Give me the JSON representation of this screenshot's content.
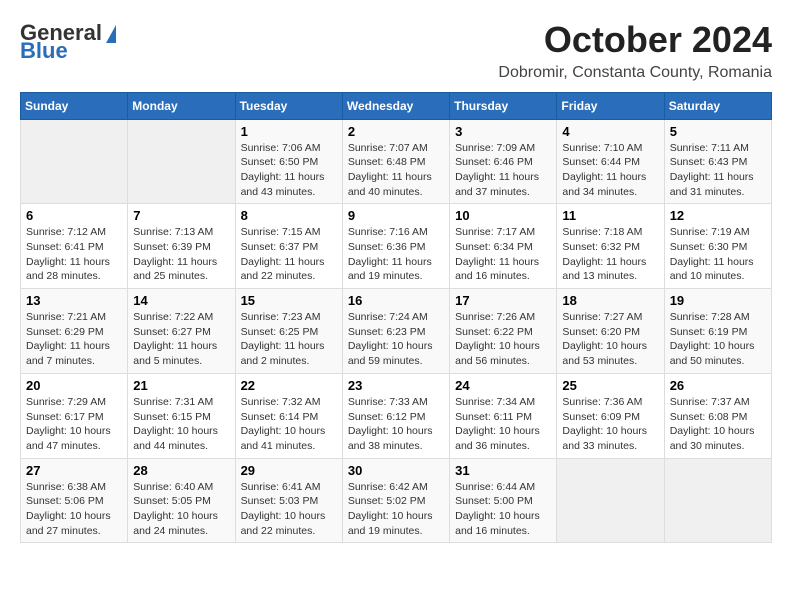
{
  "header": {
    "logo_general": "General",
    "logo_blue": "Blue",
    "month_title": "October 2024",
    "location": "Dobromir, Constanta County, Romania"
  },
  "days_of_week": [
    "Sunday",
    "Monday",
    "Tuesday",
    "Wednesday",
    "Thursday",
    "Friday",
    "Saturday"
  ],
  "weeks": [
    [
      null,
      null,
      {
        "day": 1,
        "sunrise": "7:06 AM",
        "sunset": "6:50 PM",
        "daylight": "11 hours and 43 minutes."
      },
      {
        "day": 2,
        "sunrise": "7:07 AM",
        "sunset": "6:48 PM",
        "daylight": "11 hours and 40 minutes."
      },
      {
        "day": 3,
        "sunrise": "7:09 AM",
        "sunset": "6:46 PM",
        "daylight": "11 hours and 37 minutes."
      },
      {
        "day": 4,
        "sunrise": "7:10 AM",
        "sunset": "6:44 PM",
        "daylight": "11 hours and 34 minutes."
      },
      {
        "day": 5,
        "sunrise": "7:11 AM",
        "sunset": "6:43 PM",
        "daylight": "11 hours and 31 minutes."
      }
    ],
    [
      {
        "day": 6,
        "sunrise": "7:12 AM",
        "sunset": "6:41 PM",
        "daylight": "11 hours and 28 minutes."
      },
      {
        "day": 7,
        "sunrise": "7:13 AM",
        "sunset": "6:39 PM",
        "daylight": "11 hours and 25 minutes."
      },
      {
        "day": 8,
        "sunrise": "7:15 AM",
        "sunset": "6:37 PM",
        "daylight": "11 hours and 22 minutes."
      },
      {
        "day": 9,
        "sunrise": "7:16 AM",
        "sunset": "6:36 PM",
        "daylight": "11 hours and 19 minutes."
      },
      {
        "day": 10,
        "sunrise": "7:17 AM",
        "sunset": "6:34 PM",
        "daylight": "11 hours and 16 minutes."
      },
      {
        "day": 11,
        "sunrise": "7:18 AM",
        "sunset": "6:32 PM",
        "daylight": "11 hours and 13 minutes."
      },
      {
        "day": 12,
        "sunrise": "7:19 AM",
        "sunset": "6:30 PM",
        "daylight": "11 hours and 10 minutes."
      }
    ],
    [
      {
        "day": 13,
        "sunrise": "7:21 AM",
        "sunset": "6:29 PM",
        "daylight": "11 hours and 7 minutes."
      },
      {
        "day": 14,
        "sunrise": "7:22 AM",
        "sunset": "6:27 PM",
        "daylight": "11 hours and 5 minutes."
      },
      {
        "day": 15,
        "sunrise": "7:23 AM",
        "sunset": "6:25 PM",
        "daylight": "11 hours and 2 minutes."
      },
      {
        "day": 16,
        "sunrise": "7:24 AM",
        "sunset": "6:23 PM",
        "daylight": "10 hours and 59 minutes."
      },
      {
        "day": 17,
        "sunrise": "7:26 AM",
        "sunset": "6:22 PM",
        "daylight": "10 hours and 56 minutes."
      },
      {
        "day": 18,
        "sunrise": "7:27 AM",
        "sunset": "6:20 PM",
        "daylight": "10 hours and 53 minutes."
      },
      {
        "day": 19,
        "sunrise": "7:28 AM",
        "sunset": "6:19 PM",
        "daylight": "10 hours and 50 minutes."
      }
    ],
    [
      {
        "day": 20,
        "sunrise": "7:29 AM",
        "sunset": "6:17 PM",
        "daylight": "10 hours and 47 minutes."
      },
      {
        "day": 21,
        "sunrise": "7:31 AM",
        "sunset": "6:15 PM",
        "daylight": "10 hours and 44 minutes."
      },
      {
        "day": 22,
        "sunrise": "7:32 AM",
        "sunset": "6:14 PM",
        "daylight": "10 hours and 41 minutes."
      },
      {
        "day": 23,
        "sunrise": "7:33 AM",
        "sunset": "6:12 PM",
        "daylight": "10 hours and 38 minutes."
      },
      {
        "day": 24,
        "sunrise": "7:34 AM",
        "sunset": "6:11 PM",
        "daylight": "10 hours and 36 minutes."
      },
      {
        "day": 25,
        "sunrise": "7:36 AM",
        "sunset": "6:09 PM",
        "daylight": "10 hours and 33 minutes."
      },
      {
        "day": 26,
        "sunrise": "7:37 AM",
        "sunset": "6:08 PM",
        "daylight": "10 hours and 30 minutes."
      }
    ],
    [
      {
        "day": 27,
        "sunrise": "6:38 AM",
        "sunset": "5:06 PM",
        "daylight": "10 hours and 27 minutes."
      },
      {
        "day": 28,
        "sunrise": "6:40 AM",
        "sunset": "5:05 PM",
        "daylight": "10 hours and 24 minutes."
      },
      {
        "day": 29,
        "sunrise": "6:41 AM",
        "sunset": "5:03 PM",
        "daylight": "10 hours and 22 minutes."
      },
      {
        "day": 30,
        "sunrise": "6:42 AM",
        "sunset": "5:02 PM",
        "daylight": "10 hours and 19 minutes."
      },
      {
        "day": 31,
        "sunrise": "6:44 AM",
        "sunset": "5:00 PM",
        "daylight": "10 hours and 16 minutes."
      },
      null,
      null
    ]
  ]
}
